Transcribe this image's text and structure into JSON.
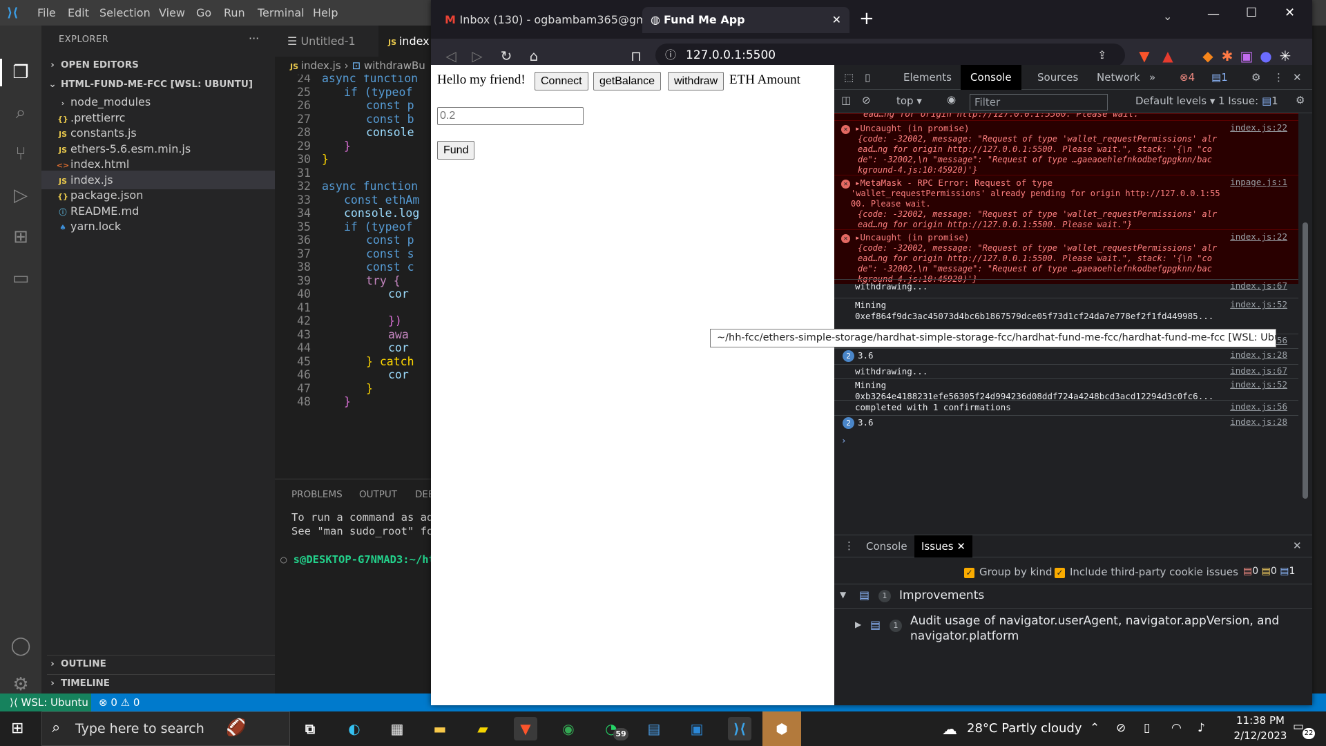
{
  "vscode": {
    "menu": [
      "File",
      "Edit",
      "Selection",
      "View",
      "Go",
      "Run",
      "Terminal",
      "Help"
    ],
    "explorer_title": "EXPLORER",
    "open_editors": "OPEN EDITORS",
    "workspace": "HTML-FUND-ME-FCC [WSL: UBUNTU]",
    "files": [
      {
        "name": "node_modules",
        "icon": "folder-icon"
      },
      {
        "name": ".prettierrc",
        "icon": "json-icon"
      },
      {
        "name": "constants.js",
        "icon": "js-icon"
      },
      {
        "name": "ethers-5.6.esm.min.js",
        "icon": "js-icon"
      },
      {
        "name": "index.html",
        "icon": "html-icon"
      },
      {
        "name": "index.js",
        "icon": "js-icon"
      },
      {
        "name": "package.json",
        "icon": "json-icon"
      },
      {
        "name": "README.md",
        "icon": "info-icon"
      },
      {
        "name": "yarn.lock",
        "icon": "yarn-icon"
      }
    ],
    "outline": "OUTLINE",
    "timeline": "TIMELINE",
    "tabs": [
      "Untitled-1",
      "index"
    ],
    "breadcrumb_file": "index.js",
    "breadcrumb_symbol": "withdrawBu",
    "code_lines": [
      {
        "n": "24",
        "t": "async function"
      },
      {
        "n": "25",
        "t": "if (typeof"
      },
      {
        "n": "26",
        "t": "const p"
      },
      {
        "n": "27",
        "t": "const b"
      },
      {
        "n": "28",
        "t": "console"
      },
      {
        "n": "29",
        "t": "}"
      },
      {
        "n": "30",
        "t": "}"
      },
      {
        "n": "31",
        "t": ""
      },
      {
        "n": "32",
        "t": "async function"
      },
      {
        "n": "33",
        "t": "const ethAm"
      },
      {
        "n": "34",
        "t": "console.log"
      },
      {
        "n": "35",
        "t": "if (typeof"
      },
      {
        "n": "36",
        "t": "const p"
      },
      {
        "n": "37",
        "t": "const s"
      },
      {
        "n": "38",
        "t": "const c"
      },
      {
        "n": "39",
        "t": "try {"
      },
      {
        "n": "40",
        "t": "cor"
      },
      {
        "n": "41",
        "t": ""
      },
      {
        "n": "42",
        "t": "})"
      },
      {
        "n": "43",
        "t": "awa"
      },
      {
        "n": "44",
        "t": "cor"
      },
      {
        "n": "45",
        "t": "} catch"
      },
      {
        "n": "46",
        "t": "cor"
      },
      {
        "n": "47",
        "t": "}"
      },
      {
        "n": "48",
        "t": "}"
      }
    ],
    "panel_tabs": [
      "PROBLEMS",
      "OUTPUT",
      "DEB"
    ],
    "terminal_lines": [
      "To run a command as adr",
      "See \"man sudo_root\" fo"
    ],
    "prompt": "s@DESKTOP-G7NMAD3:~/htr",
    "status_remote": "WSL: Ubuntu",
    "status_errors": "0",
    "status_warnings": "0"
  },
  "browser": {
    "tabs": [
      {
        "label": "Inbox (130) - ogbambam365@gmail.c",
        "icon": "gmail-icon"
      },
      {
        "label": "Fund Me App",
        "icon": "globe-icon"
      }
    ],
    "url": "127.0.0.1:5500",
    "page": {
      "greeting": "Hello my friend!",
      "connect": "Connect",
      "get_balance": "getBalance",
      "withdraw": "withdraw",
      "eth_label": "ETH Amount",
      "amount_placeholder": "0.2",
      "fund": "Fund"
    }
  },
  "devtools": {
    "tabs": [
      "Elements",
      "Console",
      "Sources",
      "Network"
    ],
    "error_count": "4",
    "info_count": "1",
    "context": "top",
    "filter_placeholder": "Filter",
    "levels": "Default levels",
    "issues": "1 Issue:",
    "issues_count": "1",
    "top_partial": "ead…ng for origin http://127.0.0.1:5500. Please wait.",
    "errors": [
      {
        "head": "Uncaught (in promise)",
        "src": "index.js:22",
        "lines": [
          "{code: -32002, message: \"Request of type 'wallet_requestPermissions' alr",
          "ead…ng for origin http://127.0.0.1:5500. Please wait.\", stack: '{\\n  \"co",
          "de\": -32002,\\n  \"message\": \"Request of type …gaeaoehlefnkodbefgpgknn/bac",
          "kground-4.js:10:45920)'}"
        ]
      },
      {
        "head": "MetaMask - RPC Error: Request of type",
        "src": "inpage.js:1",
        "lines": [
          "'wallet_requestPermissions' already pending for origin http://127.0.0.1:55",
          "00. Please wait.",
          "{code: -32002, message: \"Request of type 'wallet_requestPermissions' alr",
          "ead…ng for origin http://127.0.0.1:5500. Please wait.\"}"
        ]
      },
      {
        "head": "Uncaught (in promise)",
        "src": "index.js:22",
        "lines": [
          "{code: -32002, message: \"Request of type 'wallet_requestPermissions' alr",
          "ead…ng for origin http://127.0.0.1:5500. Please wait.\", stack: '{\\n  \"co",
          "de\": -32002,\\n  \"message\": \"Request of type …gaeaoehlefnkodbefgpgknn/bac",
          "kground-4.js:10:45920)'}"
        ]
      }
    ],
    "logs": [
      {
        "text": "withdrawing...",
        "src": "index.js:67",
        "text2": ""
      },
      {
        "text": "Mining",
        "src": "index.js:52",
        "text2": "0xef864f9dc3ac45073d4bc6b1867579dce05f73d1cf24da7e778ef2f1fd449985..."
      },
      {
        "text": "completed with 1 confirmations",
        "src": "index.js:56",
        "text2": ""
      },
      {
        "text": "3.6",
        "src": "index.js:28",
        "text2": "",
        "count": "2"
      },
      {
        "text": "withdrawing...",
        "src": "index.js:67",
        "text2": ""
      },
      {
        "text": "Mining",
        "src": "index.js:52",
        "text2": "0xb3264e4188231efe56305f24d994236d08ddf724a4248bcd3acd12294d3c0fc6..."
      },
      {
        "text": "completed with 1 confirmations",
        "src": "index.js:56",
        "text2": ""
      },
      {
        "text": "3.6",
        "src": "index.js:28",
        "text2": "",
        "count": "2"
      }
    ],
    "drawer_tabs": [
      "Console",
      "Issues"
    ],
    "group_by_kind": "Group by kind",
    "third_party": "Include third-party cookie issues",
    "drawer_counts": {
      "errors": "0",
      "warnings": "0",
      "info": "1"
    },
    "improvements": "Improvements",
    "improvements_count": "1",
    "issue_text_1": "Audit usage of navigator.userAgent, navigator.appVersion, and",
    "issue_text_2": "navigator.platform",
    "issue_count": "1"
  },
  "tooltip": "~/hh-fcc/ethers-simple-storage/hardhat-simple-storage-fcc/hardhat-fund-me-fcc/hardhat-fund-me-fcc [WSL: Ubuntu]",
  "taskbar": {
    "search_placeholder": "Type here to search",
    "whatsapp_badge": "59",
    "weather": "28°C  Partly cloudy",
    "time": "11:38 PM",
    "date": "2/12/2023",
    "notifications": "22"
  }
}
